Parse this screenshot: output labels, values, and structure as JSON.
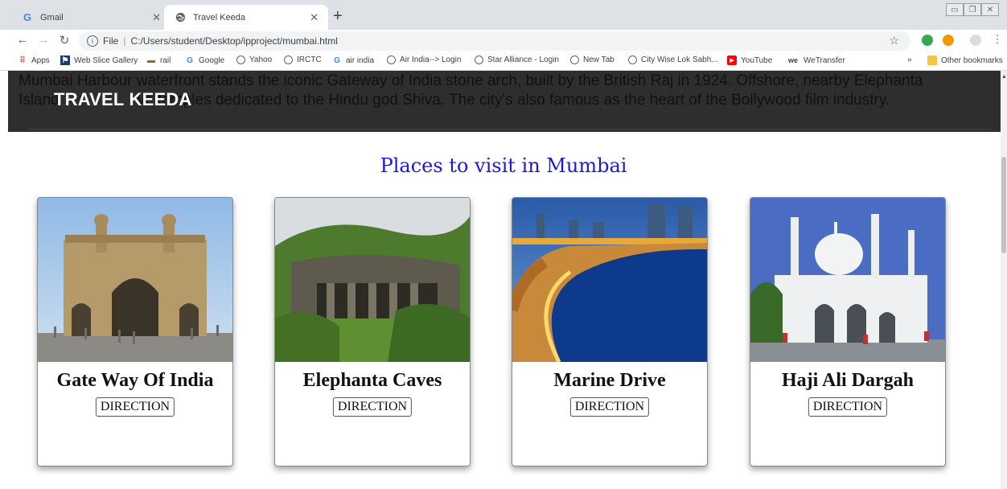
{
  "browser": {
    "tabs": [
      {
        "title": "Gmail",
        "favicon": "G"
      },
      {
        "title": "Travel Keeda",
        "favicon": "globe"
      }
    ],
    "new_tab": "+",
    "url_scheme": "File",
    "url": "C:/Users/student/Desktop/ipproject/mumbai.html",
    "bookmarks": [
      "Apps",
      "Web Slice Gallery",
      "rail",
      "Google",
      "Yahoo",
      "IRCTC",
      "air india",
      "Air India--> Login",
      "Star Alliance - Login",
      "New Tab",
      "City Wise Lok Sabh...",
      "YouTube",
      "WeTransfer"
    ],
    "more_bookmarks": "»",
    "other_bookmarks": "Other bookmarks"
  },
  "page": {
    "hero_line1": "Mumbai Harbour waterfront stands the iconic Gateway of India stone arch, built by the British Raj in 1924. Offshore, nearby Elephanta",
    "hero_line2_left": "Island",
    "hero_line2_right": "ve temples dedicated to the Hindu god Shiva. The city's also famous as the heart of the Bollywood film industry.",
    "brand": "TRAVEL KEEDA",
    "section_title": "Places to visit in Mumbai",
    "cards": [
      {
        "name": "Gate Way Of India",
        "button": "DIRECTION"
      },
      {
        "name": "Elephanta Caves",
        "button": "DIRECTION"
      },
      {
        "name": "Marine Drive",
        "button": "DIRECTION"
      },
      {
        "name": "Haji Ali Dargah",
        "button": "DIRECTION"
      }
    ]
  },
  "colors": {
    "title_blue": "#1a1ad8",
    "hero_bg": "#2e2e2e",
    "tabstrip": "#dee1e6"
  }
}
